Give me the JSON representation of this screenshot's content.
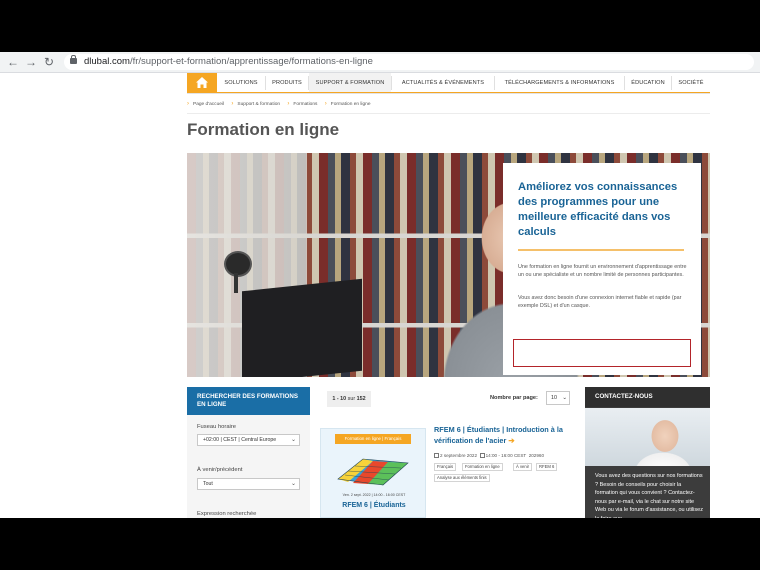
{
  "browser": {
    "url_domain": "dlubal.com",
    "url_path": "/fr/support-et-formation/apprentissage/formations-en-ligne"
  },
  "nav": {
    "items": [
      {
        "label": "SOLUTIONS"
      },
      {
        "label": "PRODUITS"
      },
      {
        "label": "SUPPORT & FORMATION"
      },
      {
        "label": "ACTUALITÉS & ÉVÉNEMENTS"
      },
      {
        "label": "TÉLÉCHARGEMENTS & INFORMATIONS"
      },
      {
        "label": "ÉDUCATION"
      },
      {
        "label": "SOCIÉTÉ"
      }
    ]
  },
  "breadcrumb": [
    "Page d'accueil",
    "Support & formation",
    "Formations",
    "Formation en ligne"
  ],
  "page_title": "Formation en ligne",
  "hero": {
    "heading": "Améliorez vos connaissances des programmes pour une meilleure efficacité dans vos calculs",
    "para1": "Une formation en ligne fournit un environnement d'apprentissage entre un ou une spécialiste et un nombre limité de personnes participantes.",
    "para2": "Vous avez donc besoin d'une connexion internet fiable et rapide (par exemple DSL) et d'un casque."
  },
  "search": {
    "header": "RECHERCHER DES FORMATIONS EN LIGNE",
    "timezone_label": "Fuseau horaire",
    "timezone_value": "+02:00 | CEST | Central Europe",
    "upcoming_label": "À venir/précédent",
    "upcoming_value": "Tout",
    "expression_label": "Expression recherchée"
  },
  "results": {
    "range": "1 - 10",
    "of_word": "sur",
    "total": "152",
    "per_page_label": "Nombre par page:",
    "per_page_value": "10"
  },
  "course": {
    "badge": "Formation en ligne | Français",
    "thumb_date": "Ven. 2 sept. 2022 | 14:00 - 16:00 CEST",
    "thumb_title": "RFEM 6 | Étudiants",
    "title": "RFEM 6 | Étudiants | Introduction à la vérification de l'acier",
    "arrow": "➔",
    "date": "2 septembre 2022",
    "time": "14:00 - 16:00 CEST",
    "code": "202960",
    "tags": [
      "Français",
      "Formation en ligne",
      "À venir",
      "RFEM 6",
      "Analyse aux éléments finis"
    ]
  },
  "contact": {
    "header": "CONTACTEZ-NOUS",
    "text": "Vous avez des questions sur nos formations ? Besoin de conseils pour choisir la formation qui vous convient ? Contactez-nous par e-mail, via le chat sur notre site Web ou via le forum d'assistance, ou utilisez la foire aux"
  },
  "colors": {
    "accent": "#f5a623",
    "link_blue": "#1a6496",
    "panel_blue": "#1a6ea6",
    "highlight_red": "#b3242a"
  }
}
